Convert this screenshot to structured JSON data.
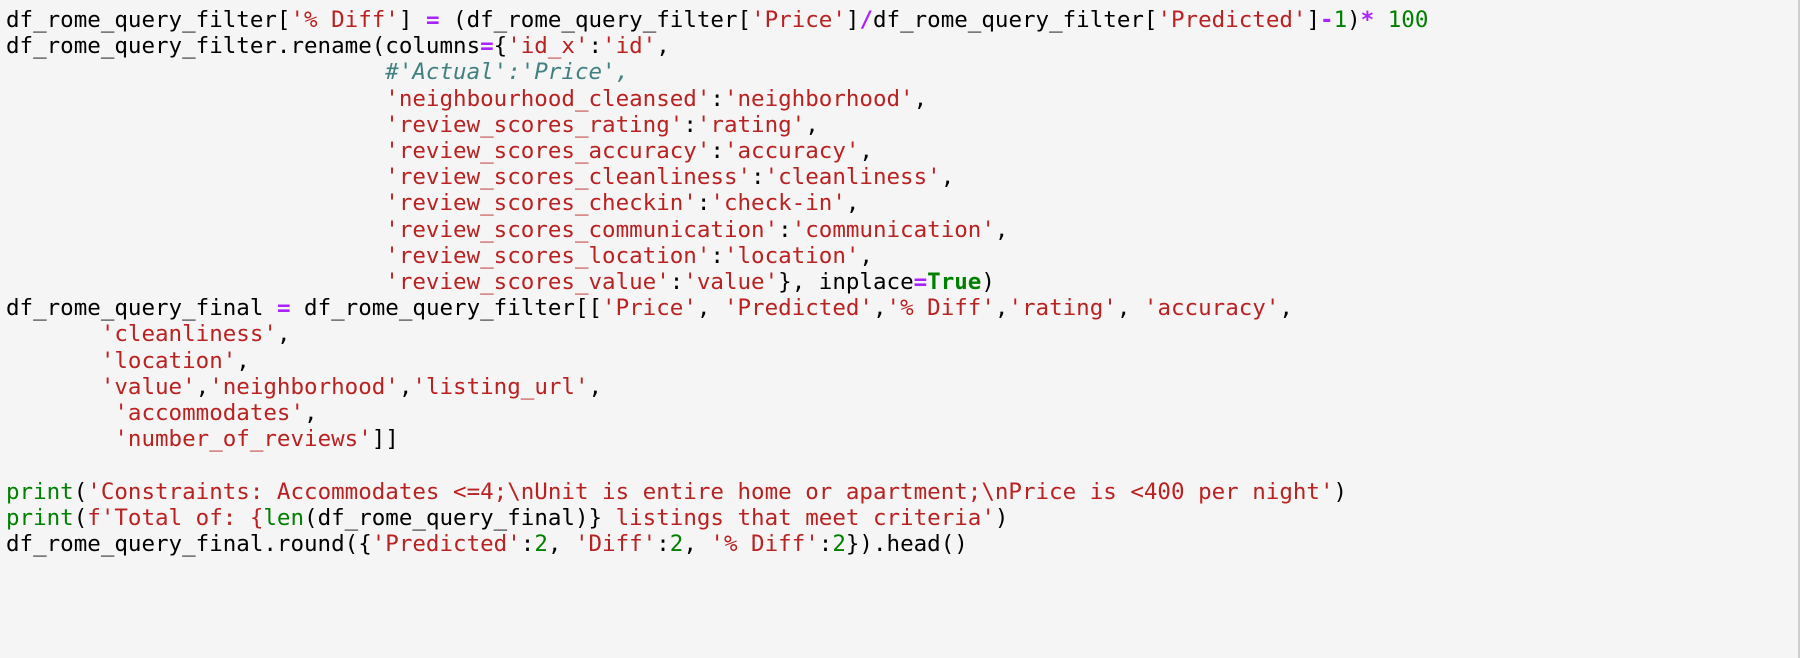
{
  "cell": {
    "kind": "jupyter-code-cell",
    "language": "python",
    "background_color": "#f5f5f5",
    "border_color": "#cfcfcf",
    "syntax_colors": {
      "default": "#000000",
      "string": "#ba2121",
      "comment": "#408080",
      "operator": "#aa22ff",
      "number": "#008000",
      "keyword": "#008000",
      "builtin": "#008000"
    },
    "lines": [
      {
        "id": "line-1",
        "tokens": [
          {
            "t": "def",
            "v": "df_rome_query_filter["
          },
          {
            "t": "str",
            "v": "'% Diff'"
          },
          {
            "t": "def",
            "v": "] "
          },
          {
            "t": "op",
            "v": "="
          },
          {
            "t": "def",
            "v": " (df_rome_query_filter["
          },
          {
            "t": "str",
            "v": "'Price'"
          },
          {
            "t": "def",
            "v": "]"
          },
          {
            "t": "op",
            "v": "/"
          },
          {
            "t": "def",
            "v": "df_rome_query_filter["
          },
          {
            "t": "str",
            "v": "'Predicted'"
          },
          {
            "t": "def",
            "v": "]"
          },
          {
            "t": "op",
            "v": "-"
          },
          {
            "t": "num",
            "v": "1"
          },
          {
            "t": "def",
            "v": ")"
          },
          {
            "t": "op",
            "v": "*"
          },
          {
            "t": "def",
            "v": " "
          },
          {
            "t": "num",
            "v": "100"
          }
        ]
      },
      {
        "id": "line-2",
        "tokens": [
          {
            "t": "def",
            "v": "df_rome_query_filter.rename(columns"
          },
          {
            "t": "op",
            "v": "="
          },
          {
            "t": "def",
            "v": "{"
          },
          {
            "t": "str",
            "v": "'id_x'"
          },
          {
            "t": "def",
            "v": ":"
          },
          {
            "t": "str",
            "v": "'id'"
          },
          {
            "t": "def",
            "v": ","
          }
        ]
      },
      {
        "id": "line-3",
        "tokens": [
          {
            "t": "def",
            "v": "                            "
          },
          {
            "t": "com",
            "v": "#'Actual':'Price',"
          }
        ]
      },
      {
        "id": "line-4",
        "tokens": [
          {
            "t": "def",
            "v": "                            "
          },
          {
            "t": "str",
            "v": "'neighbourhood_cleansed'"
          },
          {
            "t": "def",
            "v": ":"
          },
          {
            "t": "str",
            "v": "'neighborhood'"
          },
          {
            "t": "def",
            "v": ","
          }
        ]
      },
      {
        "id": "line-5",
        "tokens": [
          {
            "t": "def",
            "v": "                            "
          },
          {
            "t": "str",
            "v": "'review_scores_rating'"
          },
          {
            "t": "def",
            "v": ":"
          },
          {
            "t": "str",
            "v": "'rating'"
          },
          {
            "t": "def",
            "v": ","
          }
        ]
      },
      {
        "id": "line-6",
        "tokens": [
          {
            "t": "def",
            "v": "                            "
          },
          {
            "t": "str",
            "v": "'review_scores_accuracy'"
          },
          {
            "t": "def",
            "v": ":"
          },
          {
            "t": "str",
            "v": "'accuracy'"
          },
          {
            "t": "def",
            "v": ","
          }
        ]
      },
      {
        "id": "line-7",
        "tokens": [
          {
            "t": "def",
            "v": "                            "
          },
          {
            "t": "str",
            "v": "'review_scores_cleanliness'"
          },
          {
            "t": "def",
            "v": ":"
          },
          {
            "t": "str",
            "v": "'cleanliness'"
          },
          {
            "t": "def",
            "v": ","
          }
        ]
      },
      {
        "id": "line-8",
        "tokens": [
          {
            "t": "def",
            "v": "                            "
          },
          {
            "t": "str",
            "v": "'review_scores_checkin'"
          },
          {
            "t": "def",
            "v": ":"
          },
          {
            "t": "str",
            "v": "'check-in'"
          },
          {
            "t": "def",
            "v": ","
          }
        ]
      },
      {
        "id": "line-9",
        "tokens": [
          {
            "t": "def",
            "v": "                            "
          },
          {
            "t": "str",
            "v": "'review_scores_communication'"
          },
          {
            "t": "def",
            "v": ":"
          },
          {
            "t": "str",
            "v": "'communication'"
          },
          {
            "t": "def",
            "v": ","
          }
        ]
      },
      {
        "id": "line-10",
        "tokens": [
          {
            "t": "def",
            "v": "                            "
          },
          {
            "t": "str",
            "v": "'review_scores_location'"
          },
          {
            "t": "def",
            "v": ":"
          },
          {
            "t": "str",
            "v": "'location'"
          },
          {
            "t": "def",
            "v": ","
          }
        ]
      },
      {
        "id": "line-11",
        "tokens": [
          {
            "t": "def",
            "v": "                            "
          },
          {
            "t": "str",
            "v": "'review_scores_value'"
          },
          {
            "t": "def",
            "v": ":"
          },
          {
            "t": "str",
            "v": "'value'"
          },
          {
            "t": "def",
            "v": "}, inplace"
          },
          {
            "t": "op",
            "v": "="
          },
          {
            "t": "kw",
            "v": "True"
          },
          {
            "t": "def",
            "v": ")"
          }
        ]
      },
      {
        "id": "line-12",
        "tokens": [
          {
            "t": "def",
            "v": "df_rome_query_final "
          },
          {
            "t": "op",
            "v": "="
          },
          {
            "t": "def",
            "v": " df_rome_query_filter[["
          },
          {
            "t": "str",
            "v": "'Price'"
          },
          {
            "t": "def",
            "v": ", "
          },
          {
            "t": "str",
            "v": "'Predicted'"
          },
          {
            "t": "def",
            "v": ","
          },
          {
            "t": "str",
            "v": "'% Diff'"
          },
          {
            "t": "def",
            "v": ","
          },
          {
            "t": "str",
            "v": "'rating'"
          },
          {
            "t": "def",
            "v": ", "
          },
          {
            "t": "str",
            "v": "'accuracy'"
          },
          {
            "t": "def",
            "v": ","
          }
        ]
      },
      {
        "id": "line-13",
        "tokens": [
          {
            "t": "def",
            "v": "       "
          },
          {
            "t": "str",
            "v": "'cleanliness'"
          },
          {
            "t": "def",
            "v": ","
          }
        ]
      },
      {
        "id": "line-14",
        "tokens": [
          {
            "t": "def",
            "v": "       "
          },
          {
            "t": "str",
            "v": "'location'"
          },
          {
            "t": "def",
            "v": ","
          }
        ]
      },
      {
        "id": "line-15",
        "tokens": [
          {
            "t": "def",
            "v": "       "
          },
          {
            "t": "str",
            "v": "'value'"
          },
          {
            "t": "def",
            "v": ","
          },
          {
            "t": "str",
            "v": "'neighborhood'"
          },
          {
            "t": "def",
            "v": ","
          },
          {
            "t": "str",
            "v": "'listing_url'"
          },
          {
            "t": "def",
            "v": ","
          }
        ]
      },
      {
        "id": "line-16",
        "tokens": [
          {
            "t": "def",
            "v": "        "
          },
          {
            "t": "str",
            "v": "'accommodates'"
          },
          {
            "t": "def",
            "v": ","
          }
        ]
      },
      {
        "id": "line-17",
        "tokens": [
          {
            "t": "def",
            "v": "        "
          },
          {
            "t": "str",
            "v": "'number_of_reviews'"
          },
          {
            "t": "def",
            "v": "]]"
          }
        ]
      },
      {
        "id": "line-18",
        "tokens": []
      },
      {
        "id": "line-19",
        "tokens": [
          {
            "t": "bif",
            "v": "print"
          },
          {
            "t": "def",
            "v": "("
          },
          {
            "t": "str",
            "v": "'Constraints: Accommodates <=4;\\nUnit is entire home or apartment;\\nPrice is <400 per night'"
          },
          {
            "t": "def",
            "v": ")"
          }
        ]
      },
      {
        "id": "line-20",
        "tokens": [
          {
            "t": "bif",
            "v": "print"
          },
          {
            "t": "def",
            "v": "("
          },
          {
            "t": "str",
            "v": "f'Total of: {"
          },
          {
            "t": "bif",
            "v": "len"
          },
          {
            "t": "def",
            "v": "(df_rome_query_final)}"
          },
          {
            "t": "str",
            "v": " listings that meet criteria'"
          },
          {
            "t": "def",
            "v": ")"
          }
        ]
      },
      {
        "id": "line-21",
        "tokens": [
          {
            "t": "def",
            "v": "df_rome_query_final.round({"
          },
          {
            "t": "str",
            "v": "'Predicted'"
          },
          {
            "t": "def",
            "v": ":"
          },
          {
            "t": "num",
            "v": "2"
          },
          {
            "t": "def",
            "v": ", "
          },
          {
            "t": "str",
            "v": "'Diff'"
          },
          {
            "t": "def",
            "v": ":"
          },
          {
            "t": "num",
            "v": "2"
          },
          {
            "t": "def",
            "v": ", "
          },
          {
            "t": "str",
            "v": "'% Diff'"
          },
          {
            "t": "def",
            "v": ":"
          },
          {
            "t": "num",
            "v": "2"
          },
          {
            "t": "def",
            "v": "}).head()"
          }
        ]
      }
    ]
  }
}
